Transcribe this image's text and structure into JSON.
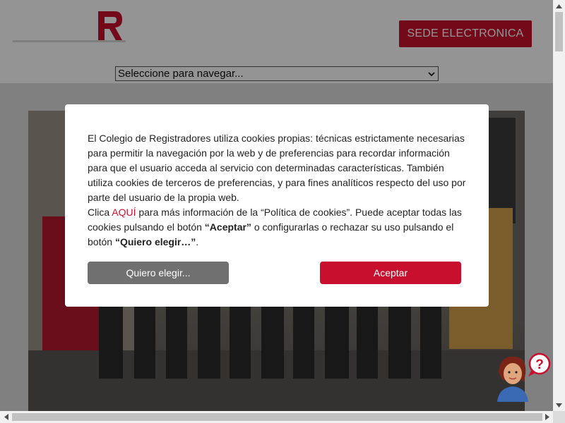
{
  "header": {
    "sede_button": "SEDE ELECTRONICA",
    "nav_select": {
      "selected": "Seleccione para navegar..."
    }
  },
  "cookie_modal": {
    "paragraph1": "El Colegio de Registradores utiliza cookies propias: técnicas estrictamente necesarias para permitir la navegación por la web y de preferencias para recordar información para que el usuario acceda al servicio con determinadas características. También utiliza cookies de terceros de preferencias, y para fines analíticos respecto del uso por parte del usuario de la propia web.",
    "p2_prefix": "Clica ",
    "p2_link": "AQUÍ",
    "p2_mid1": " para más información de la “Política de cookies”. Puede aceptar todas las cookies pulsando el botón ",
    "p2_accept_bold": "“Aceptar”",
    "p2_mid2": " o configurarlas o rechazar su uso pulsando el botón ",
    "p2_choose_bold": "“Quiero elegir…”",
    "p2_end": ".",
    "choose_button": "Quiero elegir...",
    "accept_button": "Aceptar"
  },
  "icons": {
    "logo": "registradores-logo",
    "help": "help-assistant-icon"
  },
  "colors": {
    "brand_red": "#c8102e",
    "choose_gray": "#707070",
    "overlay": "rgba(0,0,0,0.42)"
  }
}
